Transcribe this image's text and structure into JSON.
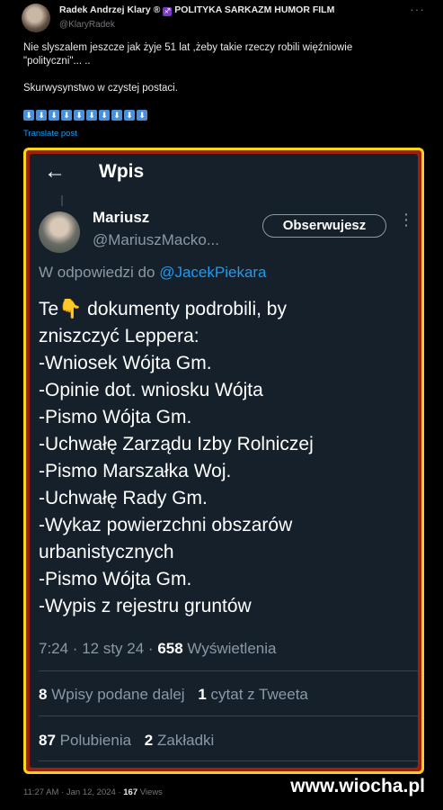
{
  "outer_post": {
    "author_name": "Radek Andrzej Klary ®",
    "author_badge": "♐",
    "author_tagline": "POLITYKA SARKAZM HUMOR FILM",
    "handle": "@KlaryRadek",
    "more_label": "···",
    "text_line1": "Nie slyszalem jeszcze jak żyje 51 lat ,żeby takie rzeczy robili więźniowie",
    "text_line2": "\"polityczni\"... ..",
    "text_line3": "Skurwysynstwo w czystej postaci.",
    "arrow_emoji": "⬇",
    "arrow_count": 10,
    "translate_label": "Translate post",
    "timestamp": "11:27 AM · Jan 12, 2024 ·",
    "views_count": "167",
    "views_label": "Views"
  },
  "embedded": {
    "back_icon": "←",
    "header_title": "Wpis",
    "author_name": "Mariusz",
    "handle": "@MariuszMacko...",
    "follow_label": "Obserwujesz",
    "more_label": "⋮",
    "reply_prefix": "W odpowiedzi do",
    "reply_mention": "@JacekPiekara",
    "lines": [
      "Te👇 dokumenty podrobili, by",
      "zniszczyć Leppera:",
      "-Wniosek Wójta Gm.",
      "-Opinie dot. wniosku Wójta",
      "-Pismo Wójta Gm.",
      "-Uchwałę Zarządu Izby Rolniczej",
      "-Pismo Marszałka Woj.",
      "-Uchwałę Rady Gm.",
      "-Wykaz powierzchni obszarów",
      "urbanistycznych",
      "-Pismo Wójta Gm.",
      "-Wypis z rejestru gruntów"
    ],
    "meta_time": "7:24 · 12 sty 24 ·",
    "meta_views_count": "658",
    "meta_views_label": "Wyświetlenia",
    "reposts_count": "8",
    "reposts_label": "Wpisy podane dalej",
    "quotes_count": "1",
    "quotes_label": "cytat z Tweeta",
    "likes_count": "87",
    "likes_label": "Polubienia",
    "bookmarks_count": "2",
    "bookmarks_label": "Zakładki"
  },
  "watermark": "www.wiocha.pl",
  "colors": {
    "accent": "#1d9bf0",
    "frame_border": "#ffd21f",
    "frame_fill": "#9c2108",
    "dim_background": "#15202b"
  }
}
